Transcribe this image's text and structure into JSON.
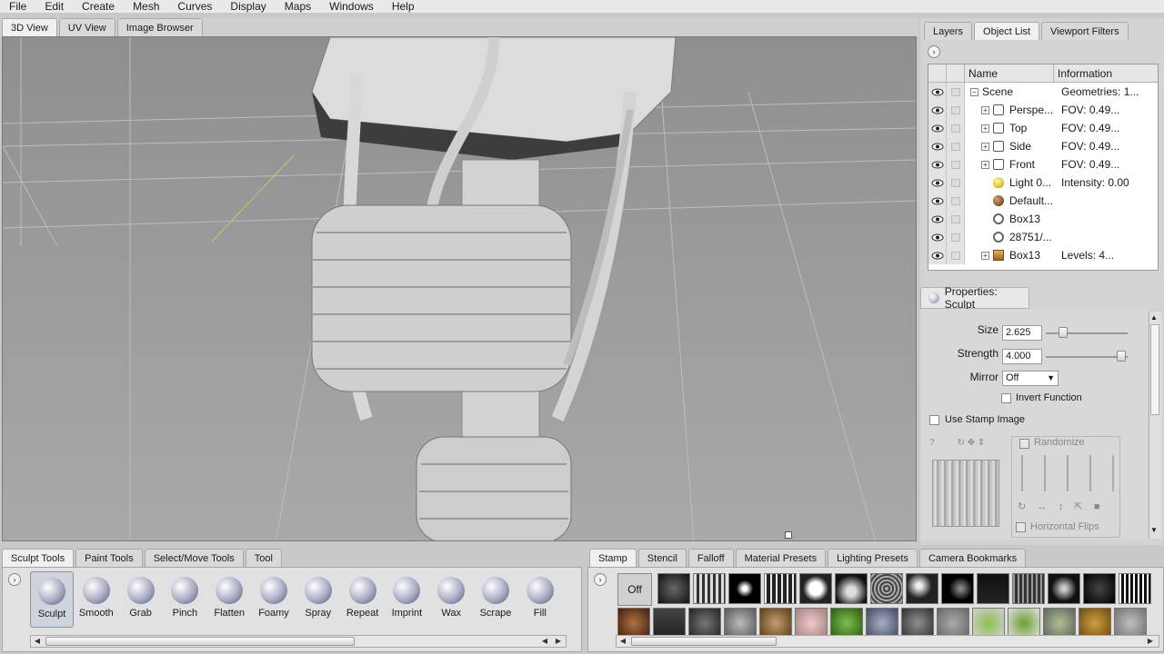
{
  "menu": [
    "File",
    "Edit",
    "Create",
    "Mesh",
    "Curves",
    "Display",
    "Maps",
    "Windows",
    "Help"
  ],
  "viewport_tabs": [
    "3D View",
    "UV View",
    "Image Browser"
  ],
  "right_tabs": [
    "Layers",
    "Object List",
    "Viewport Filters"
  ],
  "object_list": {
    "headers": {
      "name": "Name",
      "info": "Information"
    },
    "rows": [
      {
        "name": "Scene",
        "info": "Geometries: 1...",
        "icon": "scene-icon"
      },
      {
        "name": "Perspe...",
        "info": "FOV: 0.49...",
        "icon": "camera-icon"
      },
      {
        "name": "Top",
        "info": "FOV: 0.49...",
        "icon": "camera-icon"
      },
      {
        "name": "Side",
        "info": "FOV: 0.49...",
        "icon": "camera-icon"
      },
      {
        "name": "Front",
        "info": "FOV: 0.49...",
        "icon": "camera-icon"
      },
      {
        "name": "Light 0...",
        "info": "Intensity: 0.00",
        "icon": "light-bulb-icon"
      },
      {
        "name": "Default...",
        "info": "",
        "icon": "material-sphere-icon"
      },
      {
        "name": "Box13",
        "info": "",
        "icon": "geometry-icon"
      },
      {
        "name": "28751/...",
        "info": "",
        "icon": "geometry-icon"
      },
      {
        "name": "Box13",
        "info": "Levels: 4...",
        "icon": "mesh-box-icon"
      }
    ]
  },
  "properties": {
    "title": "Properties: Sculpt",
    "size_label": "Size",
    "size_value": "2.625",
    "strength_label": "Strength",
    "strength_value": "4.000",
    "mirror_label": "Mirror",
    "mirror_value": "Off",
    "invert_label": "Invert Function",
    "stamp_image_label": "Use Stamp Image",
    "randomize_label": "Randomize",
    "hflips_label": "Horizontal Flips"
  },
  "left_tray_tabs": [
    "Sculpt Tools",
    "Paint Tools",
    "Select/Move Tools",
    "Tool"
  ],
  "tools": [
    "Sculpt",
    "Smooth",
    "Grab",
    "Pinch",
    "Flatten",
    "Foamy",
    "Spray",
    "Repeat",
    "Imprint",
    "Wax",
    "Scrape",
    "Fill"
  ],
  "right_tray_tabs": [
    "Stamp",
    "Stencil",
    "Falloff",
    "Material Presets",
    "Lighting Presets",
    "Camera Bookmarks"
  ],
  "stamp_off_label": "Off",
  "colors": {
    "accent": "#4e5470",
    "viewport": "#a0a0a0",
    "panel": "#d3d3d3"
  }
}
